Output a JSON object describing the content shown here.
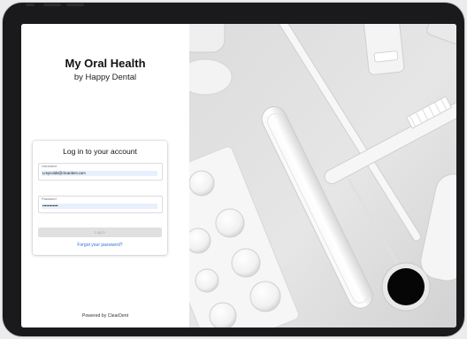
{
  "brand": {
    "title": "My Oral Health",
    "subtitle": "by Happy Dental"
  },
  "login": {
    "heading": "Log in to your account",
    "username_label": "Username",
    "username_value": "Lreynolds@cleardent.com",
    "password_label": "Password",
    "password_value": "••••••••••••",
    "login_button": "Log in",
    "forgot_link": "Forgot your password?"
  },
  "footer": {
    "powered_by": "Powered by ClearDent"
  },
  "colors": {
    "link": "#2b74d6",
    "input_fill": "#e8f0fe",
    "disabled_button": "#e0e0e0"
  },
  "hero_image": {
    "icon": "dental-tools-photo"
  }
}
